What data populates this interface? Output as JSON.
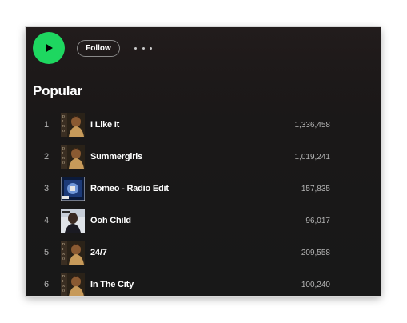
{
  "actions": {
    "follow_label": "Follow",
    "accent_color": "#1ed760"
  },
  "section": {
    "title": "Popular"
  },
  "tracks": [
    {
      "number": "1",
      "title": "I Like It",
      "plays": "1,336,458",
      "art": "dino-album-art"
    },
    {
      "number": "2",
      "title": "Summergirls",
      "plays": "1,019,241",
      "art": "dino-album-art"
    },
    {
      "number": "3",
      "title": "Romeo - Radio Edit",
      "plays": "157,835",
      "art": "romeo-single-art"
    },
    {
      "number": "4",
      "title": "Ooh Child",
      "plays": "96,017",
      "art": "ooh-child-art"
    },
    {
      "number": "5",
      "title": "24/7",
      "plays": "209,558",
      "art": "dino-album-art"
    },
    {
      "number": "6",
      "title": "In The City",
      "plays": "100,240",
      "art": "dino-album-art"
    }
  ]
}
